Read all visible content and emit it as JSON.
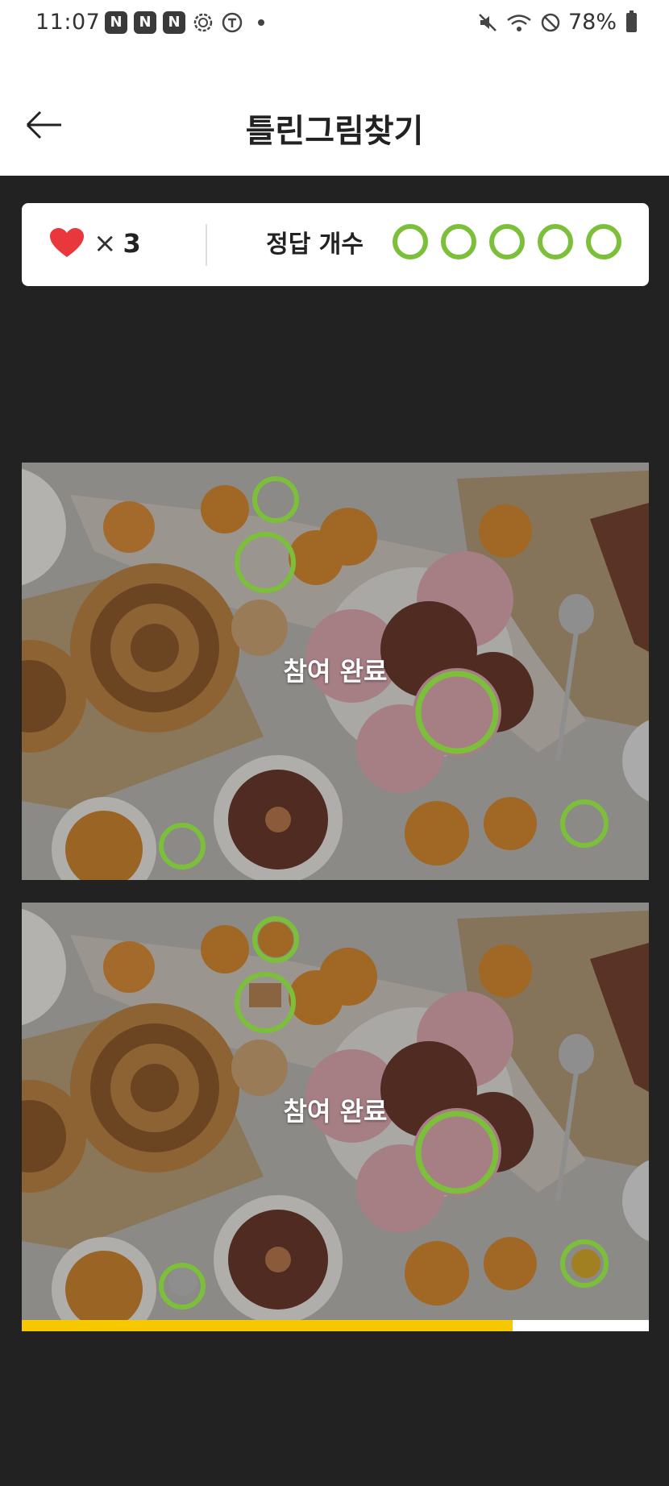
{
  "status_bar": {
    "time": "11:07",
    "battery": "78%"
  },
  "header": {
    "title": "틀린그림찾기"
  },
  "score": {
    "lives_symbol": "×",
    "lives_count": "3",
    "answers_label": "정답 개수",
    "answers_total": 5,
    "answers_found": 5
  },
  "game": {
    "overlay_text": "참여 완료"
  },
  "progress": {
    "fraction": 0.783
  },
  "colors": {
    "accent_green": "#7cbf3a",
    "heart_red": "#e8383d",
    "progress_yellow": "#f5c800"
  }
}
